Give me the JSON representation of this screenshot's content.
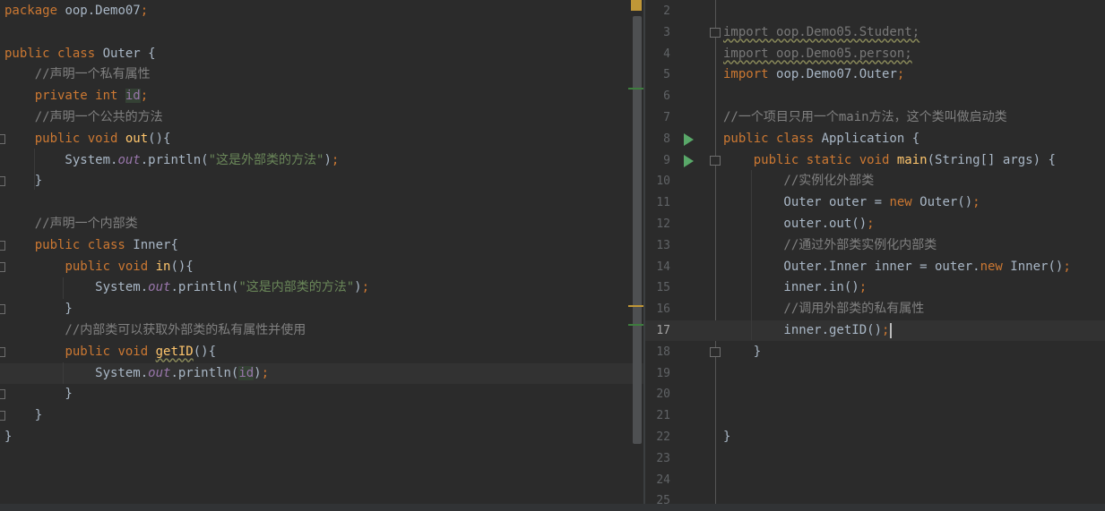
{
  "left_editor": {
    "lines": [
      {
        "spans": [
          {
            "t": "package ",
            "c": "k"
          },
          {
            "t": "oop.Demo07",
            "c": ""
          },
          {
            "t": ";",
            "c": "k"
          }
        ]
      },
      {
        "spans": []
      },
      {
        "spans": [
          {
            "t": "public class ",
            "c": "k"
          },
          {
            "t": "Outer {",
            "c": ""
          }
        ]
      },
      {
        "spans": [
          {
            "t": "    //声明一个私有属性",
            "c": "c"
          }
        ]
      },
      {
        "spans": [
          {
            "t": "    ",
            "c": ""
          },
          {
            "t": "private int ",
            "c": "k"
          },
          {
            "t": "id",
            "c": "fld"
          },
          {
            "t": ";",
            "c": "k"
          }
        ]
      },
      {
        "spans": [
          {
            "t": "    //声明一个公共的方法",
            "c": "c"
          }
        ]
      },
      {
        "spans": [
          {
            "t": "    ",
            "c": ""
          },
          {
            "t": "public void ",
            "c": "k"
          },
          {
            "t": "out",
            "c": "fn"
          },
          {
            "t": "(){",
            "c": ""
          }
        ]
      },
      {
        "spans": [
          {
            "t": "        System.",
            "c": ""
          },
          {
            "t": "out",
            "c": "f"
          },
          {
            "t": ".println(",
            "c": ""
          },
          {
            "t": "\"这是外部类的方法\"",
            "c": "s"
          },
          {
            "t": ")",
            "c": ""
          },
          {
            "t": ";",
            "c": "k"
          }
        ]
      },
      {
        "spans": [
          {
            "t": "    }",
            "c": ""
          }
        ]
      },
      {
        "spans": []
      },
      {
        "spans": [
          {
            "t": "    //声明一个内部类",
            "c": "c"
          }
        ]
      },
      {
        "spans": [
          {
            "t": "    ",
            "c": ""
          },
          {
            "t": "public class ",
            "c": "k"
          },
          {
            "t": "Inner{",
            "c": ""
          }
        ]
      },
      {
        "spans": [
          {
            "t": "        ",
            "c": ""
          },
          {
            "t": "public void ",
            "c": "k"
          },
          {
            "t": "in",
            "c": "fn"
          },
          {
            "t": "(){",
            "c": ""
          }
        ]
      },
      {
        "spans": [
          {
            "t": "            System.",
            "c": ""
          },
          {
            "t": "out",
            "c": "f"
          },
          {
            "t": ".println(",
            "c": ""
          },
          {
            "t": "\"这是内部类的方法\"",
            "c": "s"
          },
          {
            "t": ")",
            "c": ""
          },
          {
            "t": ";",
            "c": "k"
          }
        ]
      },
      {
        "spans": [
          {
            "t": "        }",
            "c": ""
          }
        ]
      },
      {
        "spans": [
          {
            "t": "        //内部类可以获取外部类的私有属性并使用",
            "c": "c"
          }
        ]
      },
      {
        "spans": [
          {
            "t": "        ",
            "c": ""
          },
          {
            "t": "public void ",
            "c": "k"
          },
          {
            "t": "getID",
            "c": "fn wavy"
          },
          {
            "t": "(){",
            "c": ""
          }
        ]
      },
      {
        "spans": [
          {
            "t": "            System.",
            "c": ""
          },
          {
            "t": "out",
            "c": "f"
          },
          {
            "t": ".println(",
            "c": ""
          },
          {
            "t": "id",
            "c": "fld"
          },
          {
            "t": ")",
            "c": ""
          },
          {
            "t": ";",
            "c": "k"
          }
        ]
      },
      {
        "spans": [
          {
            "t": "        }",
            "c": ""
          }
        ]
      },
      {
        "spans": [
          {
            "t": "    }",
            "c": ""
          }
        ]
      },
      {
        "spans": [
          {
            "t": "}",
            "c": ""
          }
        ]
      }
    ]
  },
  "right_editor": {
    "current_line": "17",
    "lines": [
      {
        "num": "2",
        "spans": []
      },
      {
        "num": "3",
        "spans": [
          {
            "t": "import oop.Demo05.Student;",
            "c": "imp wavy"
          }
        ]
      },
      {
        "num": "4",
        "spans": [
          {
            "t": "import oop.Demo05.person;",
            "c": "imp wavy"
          }
        ]
      },
      {
        "num": "5",
        "spans": [
          {
            "t": "import ",
            "c": "k"
          },
          {
            "t": "oop.Demo07.Outer",
            "c": ""
          },
          {
            "t": ";",
            "c": "k"
          }
        ]
      },
      {
        "num": "6",
        "spans": []
      },
      {
        "num": "7",
        "spans": [
          {
            "t": "//一个项目只用一个main方法，这个类叫做启动类",
            "c": "c"
          }
        ]
      },
      {
        "num": "8",
        "spans": [
          {
            "t": "public class ",
            "c": "k"
          },
          {
            "t": "Application {",
            "c": ""
          }
        ]
      },
      {
        "num": "9",
        "spans": [
          {
            "t": "    ",
            "c": ""
          },
          {
            "t": "public static void ",
            "c": "k"
          },
          {
            "t": "main",
            "c": "fn"
          },
          {
            "t": "(String[] args) {",
            "c": ""
          }
        ]
      },
      {
        "num": "10",
        "spans": [
          {
            "t": "        //实例化外部类",
            "c": "c"
          }
        ]
      },
      {
        "num": "11",
        "spans": [
          {
            "t": "        Outer outer = ",
            "c": ""
          },
          {
            "t": "new ",
            "c": "k"
          },
          {
            "t": "Outer()",
            "c": ""
          },
          {
            "t": ";",
            "c": "k"
          }
        ]
      },
      {
        "num": "12",
        "spans": [
          {
            "t": "        outer.out()",
            "c": ""
          },
          {
            "t": ";",
            "c": "k"
          }
        ]
      },
      {
        "num": "13",
        "spans": [
          {
            "t": "        //通过外部类实例化内部类",
            "c": "c"
          }
        ]
      },
      {
        "num": "14",
        "spans": [
          {
            "t": "        Outer.Inner inner = outer.",
            "c": ""
          },
          {
            "t": "new ",
            "c": "k"
          },
          {
            "t": "Inner()",
            "c": ""
          },
          {
            "t": ";",
            "c": "k"
          }
        ]
      },
      {
        "num": "15",
        "spans": [
          {
            "t": "        inner.in()",
            "c": ""
          },
          {
            "t": ";",
            "c": "k"
          }
        ]
      },
      {
        "num": "16",
        "spans": [
          {
            "t": "        //调用外部类的私有属性",
            "c": "c"
          }
        ]
      },
      {
        "num": "17",
        "spans": [
          {
            "t": "        inner.getID()",
            "c": ""
          },
          {
            "t": ";",
            "c": "k"
          }
        ]
      },
      {
        "num": "18",
        "spans": [
          {
            "t": "    }",
            "c": ""
          }
        ]
      },
      {
        "num": "19",
        "spans": []
      },
      {
        "num": "20",
        "spans": []
      },
      {
        "num": "21",
        "spans": []
      },
      {
        "num": "22",
        "spans": [
          {
            "t": "}",
            "c": ""
          }
        ]
      },
      {
        "num": "23",
        "spans": []
      },
      {
        "num": "24",
        "spans": []
      },
      {
        "num": "25",
        "spans": []
      }
    ]
  },
  "icons": {
    "run": "run-triangle-icon",
    "fold": "fold-marker-icon",
    "warning": "warning-marker-icon"
  },
  "colors": {
    "background": "#2b2b2b",
    "keyword": "#cc7832",
    "comment": "#808080",
    "string": "#6a8759",
    "static_field": "#9876aa",
    "method_decl": "#ffc66d",
    "default_text": "#a9b7c6",
    "run_icon": "#59a869",
    "warning_marker": "#c09737"
  }
}
